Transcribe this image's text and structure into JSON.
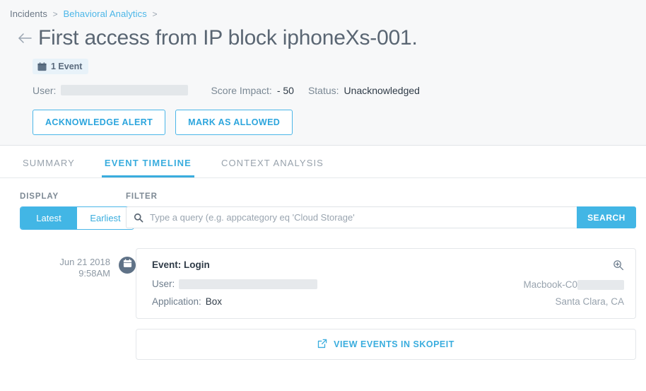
{
  "breadcrumb": {
    "items": [
      {
        "label": "Incidents",
        "link": false
      },
      {
        "label": "Behavioral Analytics",
        "link": true
      }
    ],
    "separator": ">"
  },
  "header": {
    "title": "First access from IP block iphoneXs-001.",
    "back_icon": "arrow-left-icon",
    "badge": {
      "icon": "calendar-icon",
      "label": "1 Event"
    },
    "meta": {
      "user_label": "User:",
      "user_value": "",
      "score_label": "Score Impact:",
      "score_value": "- 50",
      "status_label": "Status:",
      "status_value": "Unacknowledged"
    },
    "actions": {
      "acknowledge": "ACKNOWLEDGE ALERT",
      "mark_allowed": "MARK AS ALLOWED"
    }
  },
  "tabs": [
    {
      "label": "SUMMARY",
      "active": false
    },
    {
      "label": "EVENT TIMELINE",
      "active": true
    },
    {
      "label": "CONTEXT ANALYSIS",
      "active": false
    }
  ],
  "controls": {
    "display_label": "DISPLAY",
    "toggle": {
      "latest": "Latest",
      "earliest": "Earliest",
      "selected": "Latest"
    },
    "filter_label": "FILTER",
    "search": {
      "icon": "search-icon",
      "value": "",
      "placeholder": "Type a query (e.g. appcategory eq 'Cloud Storage'",
      "button_label": "SEARCH"
    }
  },
  "timeline": {
    "entry": {
      "date": "Jun 21 2018",
      "time": "9:58AM",
      "marker_icon": "calendar-icon",
      "event_title": "Event: Login",
      "user_label": "User:",
      "user_value": "",
      "application_label": "Application:",
      "application_value": "Box",
      "zoom_icon": "zoom-in-icon",
      "device": "Macbook-C0",
      "location": "Santa Clara, CA"
    },
    "view_events": {
      "icon": "external-link-icon",
      "label": "VIEW EVENTS IN SKOPEIT"
    }
  },
  "colors": {
    "accent": "#42b6e5",
    "link": "#3aadde",
    "header_bg": "#f7f8f9",
    "marker": "#5f7287"
  }
}
